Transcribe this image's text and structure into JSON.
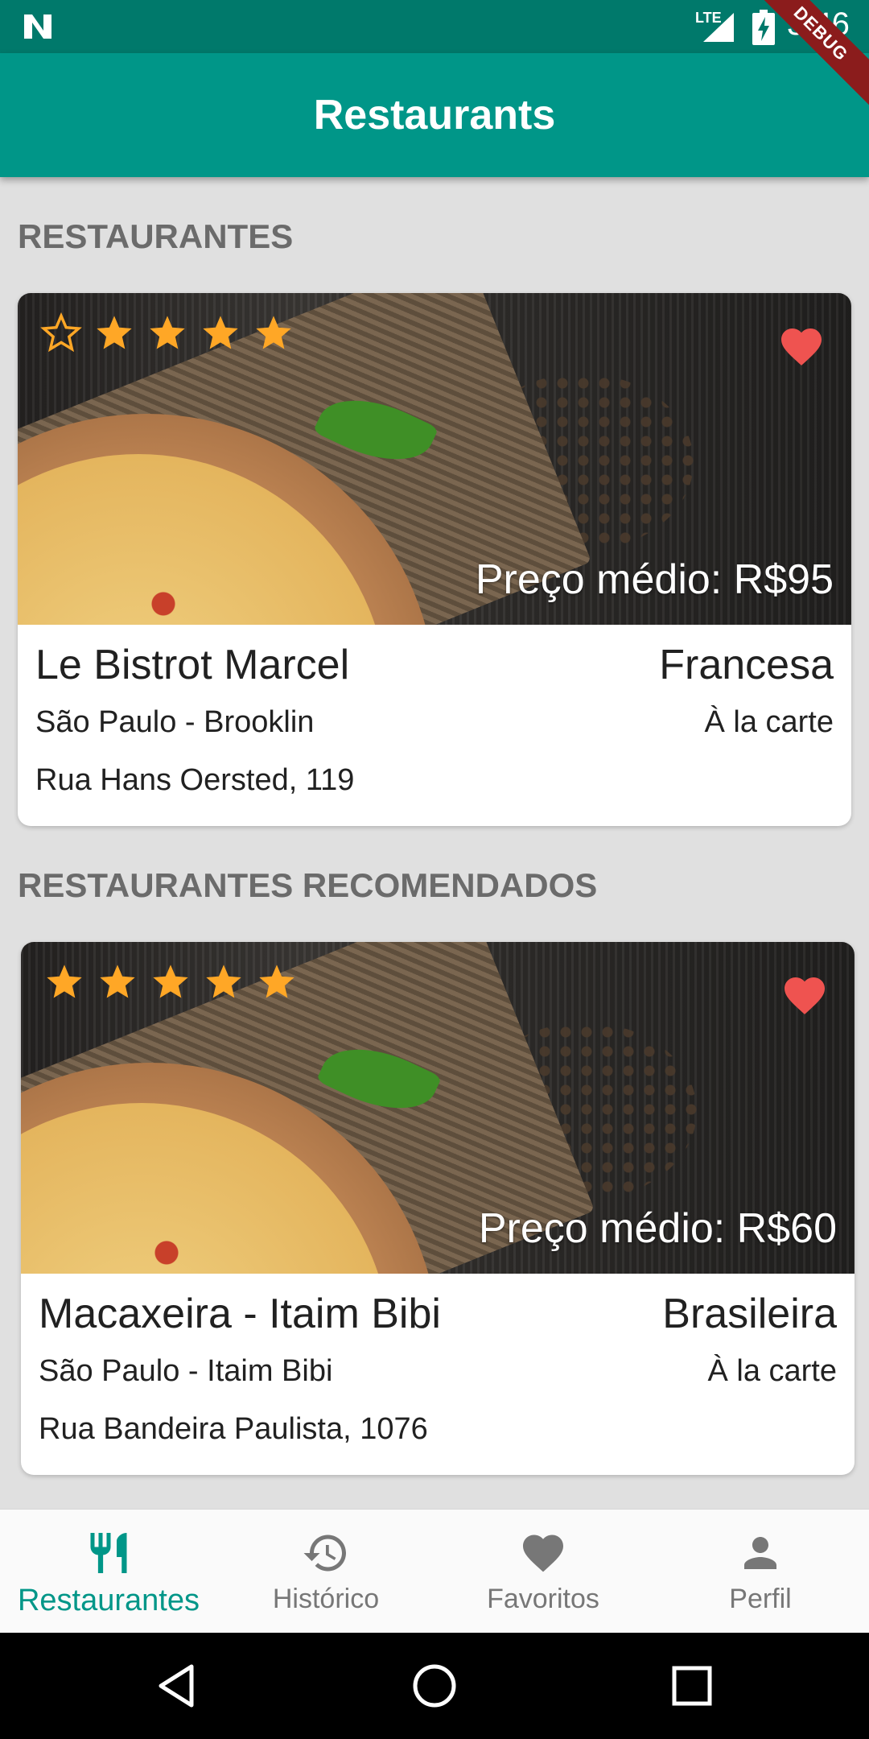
{
  "status_bar": {
    "network": "LTE",
    "time": "3:46",
    "debug_label": "DEBUG"
  },
  "app_bar": {
    "title": "Restaurants"
  },
  "sections": [
    {
      "title": "RESTAURANTES",
      "card": {
        "rating": 4,
        "stars": [
          "empty",
          "full",
          "full",
          "full",
          "full"
        ],
        "favorite": true,
        "price": "Preço médio: R$95",
        "name": "Le Bistrot Marcel",
        "cuisine": "Francesa",
        "location": "São Paulo - Brooklin",
        "service": "À la carte",
        "address": "Rua Hans Oersted, 119"
      }
    },
    {
      "title": "RESTAURANTES RECOMENDADOS",
      "card": {
        "rating": 5,
        "stars": [
          "full",
          "full",
          "full",
          "full",
          "full"
        ],
        "favorite": true,
        "price": "Preço médio: R$60",
        "name": "Macaxeira - Itaim Bibi",
        "cuisine": "Brasileira",
        "location": "São Paulo - Itaim Bibi",
        "service": "À la carte",
        "address": "Rua Bandeira Paulista, 1076"
      }
    }
  ],
  "bottom_nav": [
    {
      "label": "Restaurantes",
      "icon": "restaurant-icon",
      "active": true
    },
    {
      "label": "Histórico",
      "icon": "history-icon",
      "active": false
    },
    {
      "label": "Favoritos",
      "icon": "heart-icon",
      "active": false
    },
    {
      "label": "Perfil",
      "icon": "person-icon",
      "active": false
    }
  ],
  "colors": {
    "primary": "#009688",
    "primary_dark": "#00796b",
    "star": "#ffa726",
    "heart": "#ef5350",
    "section_title": "#6b6b6b"
  }
}
